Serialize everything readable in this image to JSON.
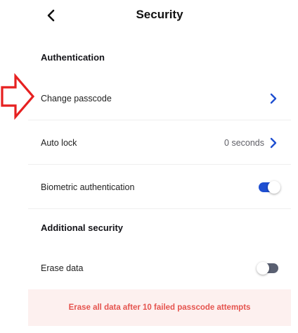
{
  "header": {
    "title": "Security",
    "back_icon": "chevron-left-icon"
  },
  "annotation": {
    "icon": "arrow-right-outline-icon",
    "color": "#e62020"
  },
  "sections": {
    "authentication": {
      "heading": "Authentication"
    },
    "additional": {
      "heading": "Additional security"
    }
  },
  "rows": {
    "change_passcode": {
      "label": "Change passcode",
      "icon": "chevron-right-icon"
    },
    "auto_lock": {
      "label": "Auto lock",
      "value": "0 seconds",
      "icon": "chevron-right-icon"
    },
    "biometric": {
      "label": "Biometric authentication",
      "toggle_on": true
    },
    "erase_data": {
      "label": "Erase data",
      "toggle_on": false
    }
  },
  "warning": {
    "text": "Erase all data after 10 failed passcode attempts"
  },
  "colors": {
    "accent": "#1f4fd1",
    "toggle_off": "#5a6072",
    "warning_text": "#e5544f",
    "warning_bg": "#fdf0ef"
  }
}
